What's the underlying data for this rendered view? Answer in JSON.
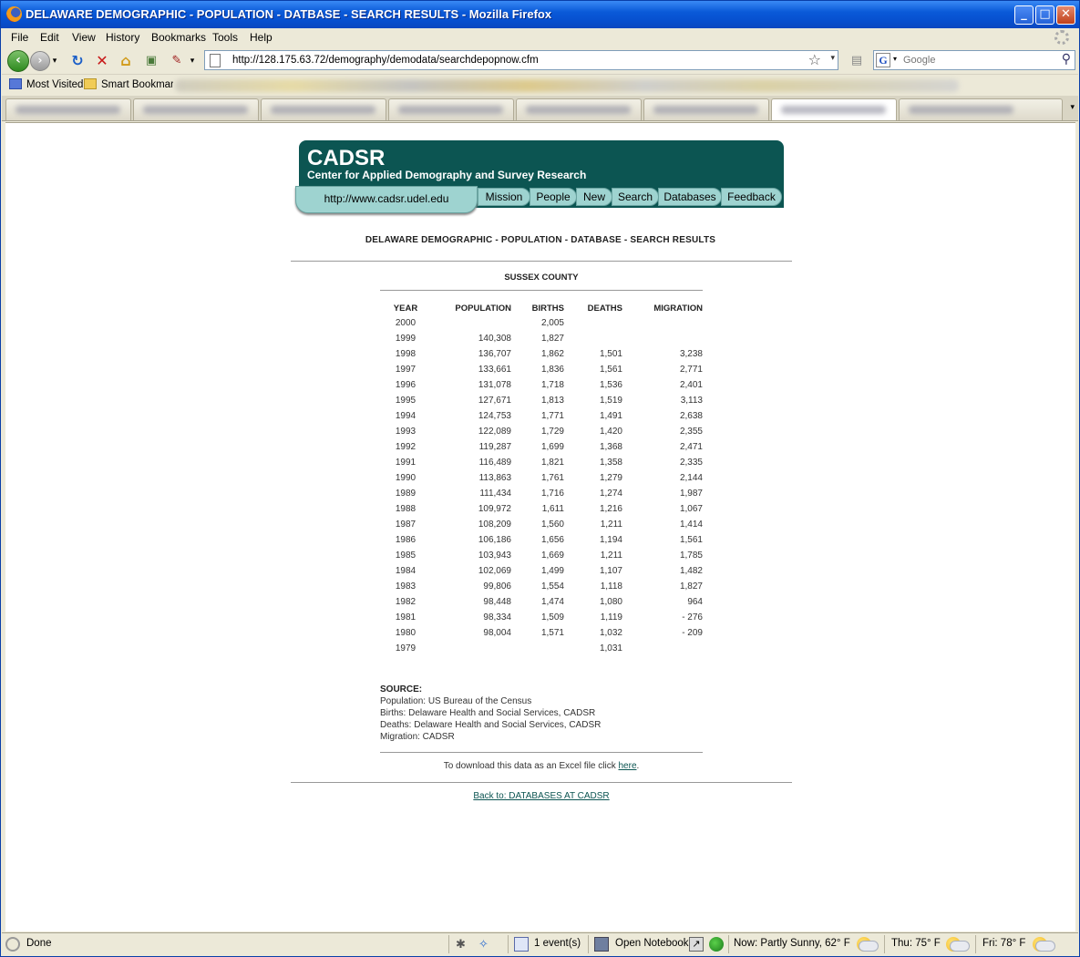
{
  "window": {
    "title": "DELAWARE DEMOGRAPHIC - POPULATION - DATBASE - SEARCH RESULTS - Mozilla Firefox",
    "minimize_glyph": "_",
    "maximize_glyph": "□",
    "close_glyph": "✕"
  },
  "menu": [
    "File",
    "Edit",
    "View",
    "History",
    "Bookmarks",
    "Tools",
    "Help"
  ],
  "navbar": {
    "url": "http://128.175.63.72/demography/demodata/searchdepopnow.cfm",
    "search_placeholder": "Google"
  },
  "bookmarks": {
    "most_visited": "Most Visited",
    "smart_bookmarks": "Smart Bookmarks"
  },
  "page": {
    "brand": "CADSR",
    "tagline": "Center for Applied Demography and Survey Research",
    "site_url": "http://www.cadsr.udel.edu",
    "nav": [
      "Mission",
      "People",
      "New",
      "Search",
      "Databases",
      "Feedback"
    ],
    "title": "DELAWARE DEMOGRAPHIC - POPULATION - DATABASE - SEARCH RESULTS",
    "county": "SUSSEX COUNTY",
    "table": {
      "headers": [
        "YEAR",
        "POPULATION",
        "BIRTHS",
        "DEATHS",
        "MIGRATION"
      ],
      "rows": [
        [
          "2000",
          "",
          "2,005",
          "",
          ""
        ],
        [
          "1999",
          "140,308",
          "1,827",
          "",
          ""
        ],
        [
          "1998",
          "136,707",
          "1,862",
          "1,501",
          "3,238"
        ],
        [
          "1997",
          "133,661",
          "1,836",
          "1,561",
          "2,771"
        ],
        [
          "1996",
          "131,078",
          "1,718",
          "1,536",
          "2,401"
        ],
        [
          "1995",
          "127,671",
          "1,813",
          "1,519",
          "3,113"
        ],
        [
          "1994",
          "124,753",
          "1,771",
          "1,491",
          "2,638"
        ],
        [
          "1993",
          "122,089",
          "1,729",
          "1,420",
          "2,355"
        ],
        [
          "1992",
          "119,287",
          "1,699",
          "1,368",
          "2,471"
        ],
        [
          "1991",
          "116,489",
          "1,821",
          "1,358",
          "2,335"
        ],
        [
          "1990",
          "113,863",
          "1,761",
          "1,279",
          "2,144"
        ],
        [
          "1989",
          "111,434",
          "1,716",
          "1,274",
          "1,987"
        ],
        [
          "1988",
          "109,972",
          "1,611",
          "1,216",
          "1,067"
        ],
        [
          "1987",
          "108,209",
          "1,560",
          "1,211",
          "1,414"
        ],
        [
          "1986",
          "106,186",
          "1,656",
          "1,194",
          "1,561"
        ],
        [
          "1985",
          "103,943",
          "1,669",
          "1,211",
          "1,785"
        ],
        [
          "1984",
          "102,069",
          "1,499",
          "1,107",
          "1,482"
        ],
        [
          "1983",
          "99,806",
          "1,554",
          "1,118",
          "1,827"
        ],
        [
          "1982",
          "98,448",
          "1,474",
          "1,080",
          "964"
        ],
        [
          "1981",
          "98,334",
          "1,509",
          "1,119",
          "- 276"
        ],
        [
          "1980",
          "98,004",
          "1,571",
          "1,032",
          "- 209"
        ],
        [
          "1979",
          "",
          "",
          "1,031",
          ""
        ]
      ]
    },
    "source": {
      "label": "SOURCE:",
      "lines": [
        "Population: US Bureau of the Census",
        "Births: Delaware Health and Social Services, CADSR",
        "Deaths: Delaware Health and Social Services, CADSR",
        "Migration: CADSR"
      ]
    },
    "download_text": "To download this data as an Excel file click ",
    "download_link": "here",
    "download_end": ".",
    "back_link": "Back to: DATABASES AT CADSR"
  },
  "status": {
    "done": "Done",
    "events": "1 event(s)",
    "notebook": "Open Notebook",
    "weather_now": "Now: Partly Sunny, 62° F",
    "weather_thu": "Thu: 75° F",
    "weather_fri": "Fri: 78° F"
  },
  "colors": {
    "banner": "#0c5552",
    "nav_tab": "#9ed3d0",
    "titlebar": "#0a5ad8"
  }
}
